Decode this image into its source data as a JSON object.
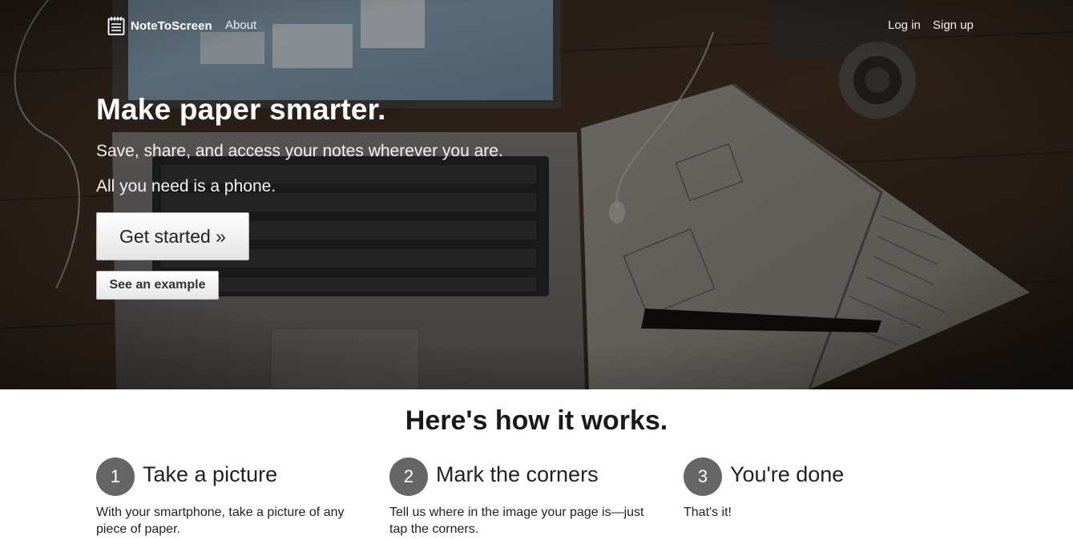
{
  "navbar": {
    "brand_name": "NoteToScreen",
    "brand_icon": "notepad-icon",
    "about_label": "About",
    "login_label": "Log in",
    "signup_label": "Sign up"
  },
  "hero": {
    "title": "Make paper smarter.",
    "subtitle_line1": "Save, share, and access your notes wherever you are.",
    "subtitle_line2": "All you need is a phone.",
    "primary_button": "Get started »",
    "secondary_button": "See an example"
  },
  "how_it_works": {
    "title": "Here's how it works.",
    "steps": [
      {
        "number": "1",
        "heading": "Take a picture",
        "text": "With your smartphone, take a picture of any piece of paper."
      },
      {
        "number": "2",
        "heading": "Mark the corners",
        "text": "Tell us where in the image your page is—just tap the corners."
      },
      {
        "number": "3",
        "heading": "You're done",
        "text": "That's it!"
      }
    ]
  },
  "colors": {
    "hero_overlay": "#000000",
    "step_circle": "#666666",
    "button_bg": "#f2f2f2"
  }
}
